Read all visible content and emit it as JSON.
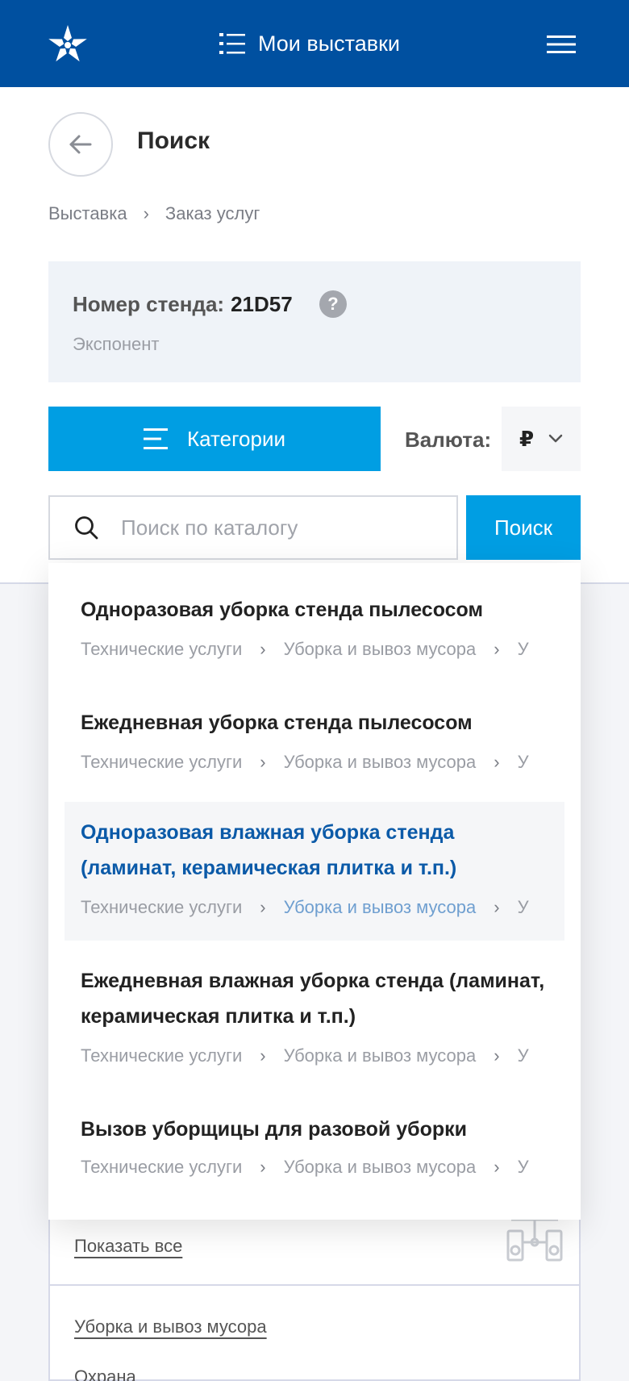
{
  "header": {
    "title": "Мои выставки",
    "logo_icon": "star-logo-icon",
    "menu_icon": "hamburger-icon"
  },
  "page": {
    "title": "Поиск"
  },
  "breadcrumb": [
    "Выставка",
    "Заказ услуг"
  ],
  "stand": {
    "label": "Номер стенда:",
    "number": "21D57",
    "help": "?",
    "role": "Экспонент"
  },
  "toolbar": {
    "categories_label": "Категории",
    "currency_label": "Валюта:",
    "currency_value": "₽"
  },
  "search": {
    "placeholder": "Поиск по каталогу",
    "value": "",
    "button_label": "Поиск"
  },
  "results": [
    {
      "title": "Одноразовая уборка стенда пылесосом",
      "path": [
        "Технические услуги",
        "Уборка и вывоз мусора",
        "У"
      ]
    },
    {
      "title": "Ежедневная уборка стенда пылесосом",
      "path": [
        "Технические услуги",
        "Уборка и вывоз мусора",
        "У"
      ]
    },
    {
      "title": "Одноразовая влажная уборка стенда (ламинат, керамическая плитка и т.п.)",
      "path": [
        "Технические услуги",
        "Уборка и вывоз мусора",
        "У"
      ]
    },
    {
      "title": "Ежедневная влажная уборка стенда (ламинат, керамическая плитка и т.п.)",
      "path": [
        "Технические услуги",
        "Уборка и вывоз мусора",
        "У"
      ]
    },
    {
      "title": "Вызов уборщицы для разовой уборки",
      "path": [
        "Технические услуги",
        "Уборка и вывоз мусора",
        "У"
      ]
    }
  ],
  "panel": {
    "show_all": "Показать все",
    "categories": [
      "Уборка и вывоз мусора",
      "Охрана"
    ]
  },
  "colors": {
    "header": "#0050a0",
    "accent": "#009ee3",
    "active_title": "#0b5aa8"
  }
}
